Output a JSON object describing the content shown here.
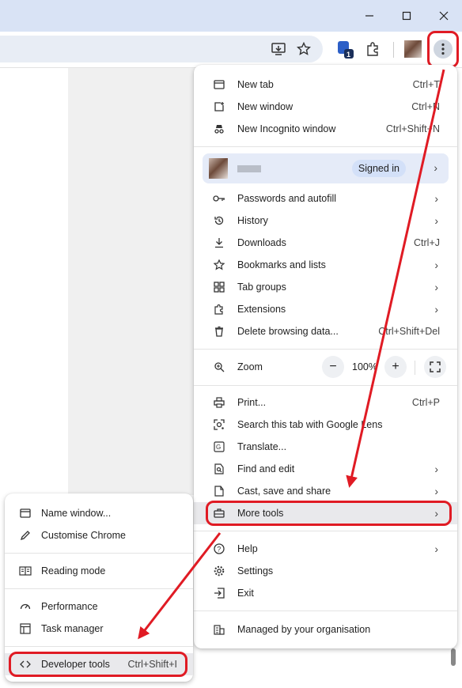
{
  "window": {
    "minimize_icon": "minimize-icon",
    "maximize_icon": "maximize-icon",
    "close_icon": "close-icon"
  },
  "toolbar": {
    "extension_badge": "1"
  },
  "menu": {
    "section1": [
      {
        "label": "New tab",
        "shortcut": "Ctrl+T",
        "icon": "new-tab-icon"
      },
      {
        "label": "New window",
        "shortcut": "Ctrl+N",
        "icon": "new-window-icon"
      },
      {
        "label": "New Incognito window",
        "shortcut": "Ctrl+Shift+N",
        "icon": "incognito-icon"
      }
    ],
    "profile": {
      "status": "Signed in"
    },
    "section2": [
      {
        "label": "Passwords and autofill",
        "icon": "key-icon"
      },
      {
        "label": "History",
        "icon": "history-icon"
      },
      {
        "label": "Downloads",
        "shortcut": "Ctrl+J",
        "icon": "download-icon"
      },
      {
        "label": "Bookmarks and lists",
        "icon": "star-icon"
      },
      {
        "label": "Tab groups",
        "icon": "tab-groups-icon"
      },
      {
        "label": "Extensions",
        "icon": "puzzle-icon"
      },
      {
        "label": "Delete browsing data...",
        "shortcut": "Ctrl+Shift+Del",
        "icon": "trash-icon"
      }
    ],
    "zoom": {
      "label": "Zoom",
      "value": "100%",
      "minus": "−",
      "plus": "+"
    },
    "section3": [
      {
        "label": "Print...",
        "shortcut": "Ctrl+P",
        "icon": "printer-icon"
      },
      {
        "label": "Search this tab with Google Lens",
        "icon": "lens-icon"
      },
      {
        "label": "Translate...",
        "icon": "translate-icon"
      },
      {
        "label": "Find and edit",
        "icon": "find-icon"
      },
      {
        "label": "Cast, save and share",
        "icon": "cast-icon"
      },
      {
        "label": "More tools",
        "icon": "toolbox-icon"
      }
    ],
    "section4": [
      {
        "label": "Help",
        "icon": "help-icon"
      },
      {
        "label": "Settings",
        "icon": "gear-icon"
      },
      {
        "label": "Exit",
        "icon": "exit-icon"
      }
    ],
    "managed": {
      "label": "Managed by your organisation",
      "icon": "building-icon"
    }
  },
  "submenu": {
    "items": [
      {
        "label": "Name window...",
        "icon": "window-icon"
      },
      {
        "label": "Customise Chrome",
        "icon": "pencil-icon"
      },
      {
        "label": "Reading mode",
        "icon": "reading-mode-icon"
      },
      {
        "label": "Performance",
        "icon": "speedometer-icon"
      },
      {
        "label": "Task manager",
        "icon": "task-manager-icon"
      },
      {
        "label": "Developer tools",
        "shortcut": "Ctrl+Shift+I",
        "icon": "code-icon"
      }
    ]
  },
  "colors": {
    "highlight": "#e01b24",
    "titlebar": "#d9e3f5",
    "profile_bg": "#e5ebf8"
  }
}
